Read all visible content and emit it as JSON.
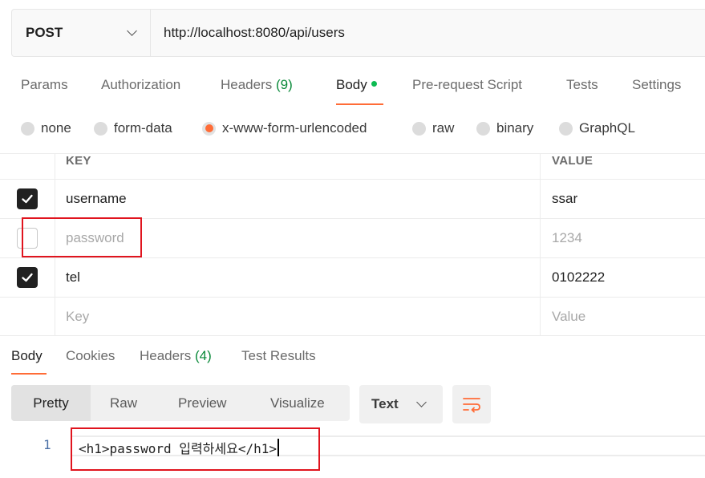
{
  "request": {
    "method": "POST",
    "url": "http://localhost:8080/api/users"
  },
  "request_tabs": [
    {
      "label": "Params"
    },
    {
      "label": "Authorization"
    },
    {
      "label": "Headers",
      "count": "(9)"
    },
    {
      "label": "Body",
      "active": true
    },
    {
      "label": "Pre-request Script"
    },
    {
      "label": "Tests"
    },
    {
      "label": "Settings"
    }
  ],
  "body_types": [
    {
      "label": "none"
    },
    {
      "label": "form-data"
    },
    {
      "label": "x-www-form-urlencoded",
      "selected": true
    },
    {
      "label": "raw"
    },
    {
      "label": "binary"
    },
    {
      "label": "GraphQL"
    }
  ],
  "params": {
    "header_key": "KEY",
    "header_value": "VALUE",
    "rows": [
      {
        "key": "username",
        "value": "ssar",
        "checked": true
      },
      {
        "key": "password",
        "value": "1234",
        "checked": false
      },
      {
        "key": "tel",
        "value": "0102222",
        "checked": true
      }
    ],
    "placeholder_key": "Key",
    "placeholder_value": "Value"
  },
  "response_tabs": [
    {
      "label": "Body",
      "active": true
    },
    {
      "label": "Cookies"
    },
    {
      "label": "Headers",
      "count": "(4)"
    },
    {
      "label": "Test Results"
    }
  ],
  "views": [
    {
      "label": "Pretty",
      "active": true
    },
    {
      "label": "Raw"
    },
    {
      "label": "Preview"
    },
    {
      "label": "Visualize"
    }
  ],
  "format": "Text",
  "code": {
    "line_number": "1",
    "text": "<h1>password 입력하세요</h1>"
  },
  "colors": {
    "accent": "#ff6c37",
    "success": "#0cbb52",
    "highlight": "#e0141e"
  }
}
